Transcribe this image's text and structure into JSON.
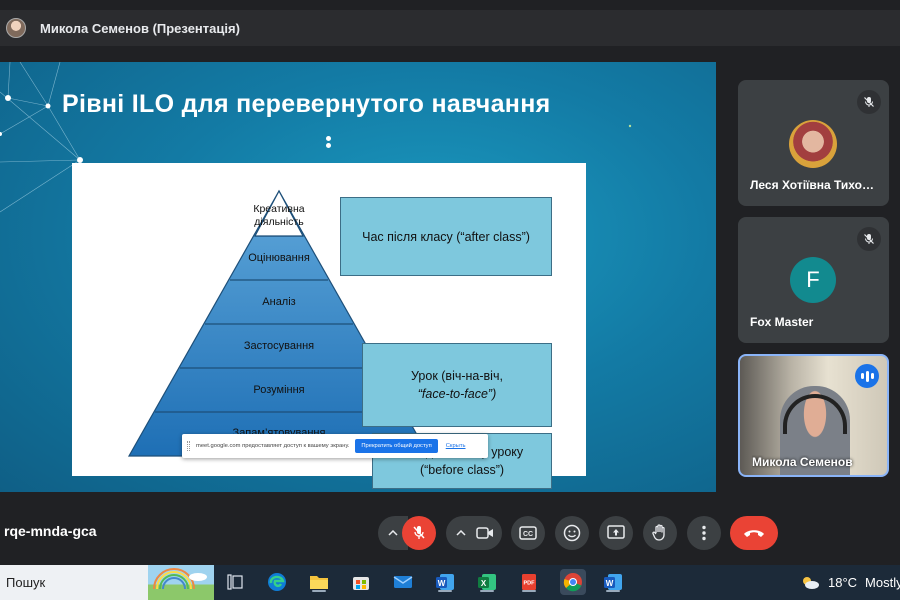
{
  "meet": {
    "presenter_title": "Микола Семенов (Презентація)",
    "meeting_code": "rqe-mnda-gca"
  },
  "slide": {
    "title": "Рівні ILO для перевернутого навчання",
    "pyramid_levels": [
      "Креативна діяльність",
      "Оцінювання",
      "Аналіз",
      "Застосування",
      "Розуміння",
      "Запам’ятовування"
    ],
    "boxes": {
      "after": "Час після класу (“after class”)",
      "lesson_line1": "Урок (віч-на-віч,",
      "lesson_line2": "“face-to-face”)",
      "before_line1": "Час до початку уроку",
      "before_line2": "(“before class”)"
    },
    "share_notice": {
      "message": "meet.google.com предоставляет доступ к вашему экрану.",
      "stop_label": "Прекратить общий доступ",
      "hide_label": "Скрыть"
    }
  },
  "participants": [
    {
      "name": "Леся Хотіївна Тихонова",
      "muted": true
    },
    {
      "name": "Fox Master",
      "initial": "F",
      "muted": true
    },
    {
      "name": "Микола Семенов",
      "speaking": true
    }
  ],
  "taskbar": {
    "search_placeholder": "Пошук",
    "apps": [
      "task-view",
      "edge",
      "file-explorer",
      "microsoft-store",
      "mail",
      "word",
      "excel",
      "pdf",
      "chrome",
      "word"
    ],
    "weather": {
      "temperature": "18°C",
      "condition": "Mostly"
    }
  },
  "colors": {
    "slide_bg": "#137ba5",
    "box_fill": "#7ec8dd",
    "pyramid_fill": "#2e86c9",
    "end_call": "#ea4335",
    "mic_off": "#ea4335",
    "fox_avatar": "#128a8f"
  }
}
